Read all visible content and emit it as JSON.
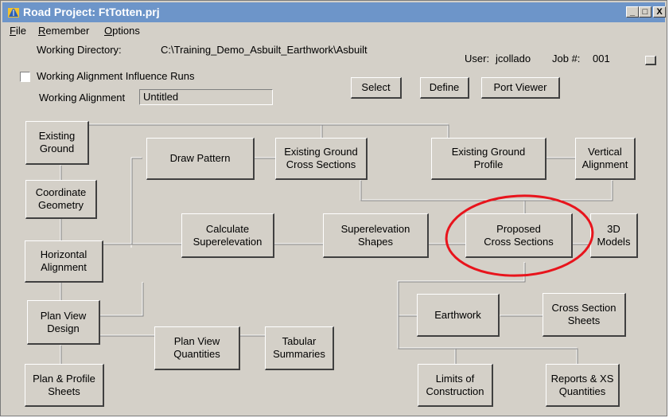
{
  "window": {
    "title": "Road Project: FtTotten.prj",
    "controls": {
      "minimize": "_",
      "maximize": "□",
      "close": "X"
    }
  },
  "menu": {
    "file": {
      "accel": "F",
      "rest": "ile"
    },
    "remember": {
      "accel": "R",
      "rest": "emember"
    },
    "options": {
      "accel": "O",
      "rest": "ptions"
    }
  },
  "header": {
    "working_directory_label": "Working Directory:",
    "working_directory_value": "C:\\Training_Demo_Asbuilt_Earthwork\\Asbuilt",
    "user_label": "User:",
    "user_value": "jcollado",
    "job_label": "Job #:",
    "job_value": "001",
    "influence_label": "Working Alignment Influence Runs",
    "influence_checked": false,
    "alignment_label": "Working Alignment",
    "alignment_value": "Untitled"
  },
  "toolbar": {
    "select": "Select",
    "define": "Define",
    "port_viewer": "Port Viewer"
  },
  "flow": {
    "existing_ground": "Existing\nGround",
    "draw_pattern": "Draw Pattern",
    "existing_ground_xs": "Existing Ground\nCross Sections",
    "existing_ground_profile": "Existing Ground\nProfile",
    "vertical_alignment": "Vertical\nAlignment",
    "coordinate_geometry": "Coordinate\nGeometry",
    "calculate_superelevation": "Calculate\nSuperelevation",
    "superelevation_shapes": "Superelevation\nShapes",
    "proposed_xs": "Proposed\nCross Sections",
    "models_3d": "3D\nModels",
    "horizontal_alignment": "Horizontal\nAlignment",
    "earthwork": "Earthwork",
    "xs_sheets": "Cross Section\nSheets",
    "plan_view_design": "Plan View\nDesign",
    "plan_view_quantities": "Plan View\nQuantities",
    "tabular_summaries": "Tabular\nSummaries",
    "plan_profile_sheets": "Plan & Profile\nSheets",
    "limits_of_construction": "Limits of\nConstruction",
    "reports_xs_quantities": "Reports & XS\nQuantities"
  },
  "highlight_color": "#e8141c",
  "title_bar_color": "#6d95c9"
}
